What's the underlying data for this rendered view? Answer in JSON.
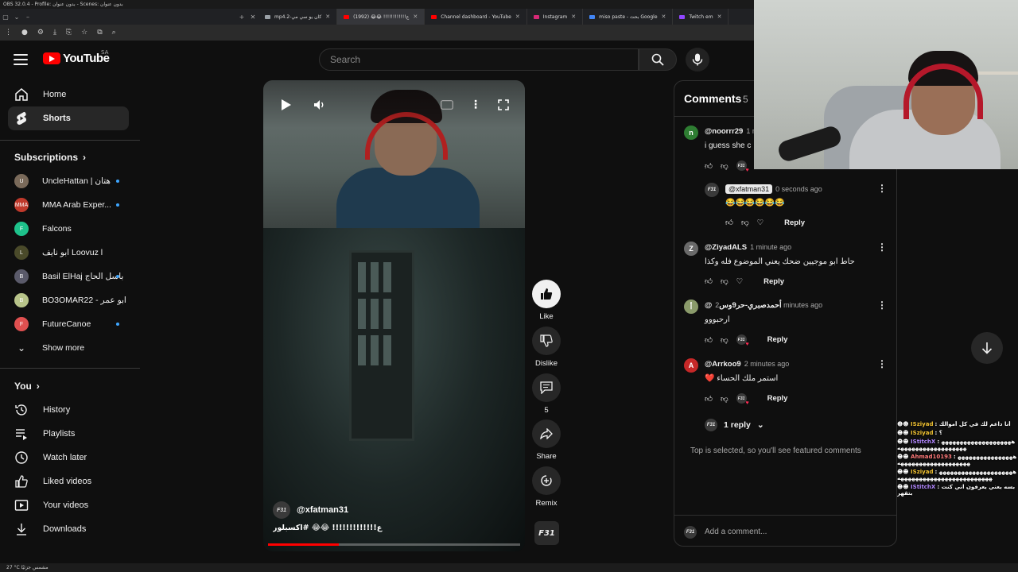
{
  "os": {
    "title": "OBS 32.0.4 - Profile: بدون عنوان - Scenes: بدون عنوان"
  },
  "browser": {
    "tabs": [
      {
        "label": "mp4.2-كان يو سي مي",
        "color": "#9aa0a6"
      },
      {
        "label": "ع!!!!!!!!!!!! 😂😂 (1992)",
        "color": "#ff0000",
        "active": true
      },
      {
        "label": "Channel dashboard - YouTube",
        "color": "#ff0000"
      },
      {
        "label": "Instagram",
        "color": "#d62976"
      },
      {
        "label": "miso paste - بحث Google",
        "color": "#4285f4"
      },
      {
        "label": "Twitch em",
        "color": "#9146ff"
      }
    ]
  },
  "header": {
    "logo_text": "YouTube",
    "country_code": "SA",
    "search_placeholder": "Search"
  },
  "sidebar": {
    "nav": [
      {
        "label": "Home",
        "icon": "home-icon"
      },
      {
        "label": "Shorts",
        "icon": "shorts-icon",
        "active": true
      }
    ],
    "subscriptions_title": "Subscriptions",
    "subscriptions": [
      {
        "name": "UncleHattan | هتان",
        "color": "#7a6a5a",
        "initial": "U",
        "new": true
      },
      {
        "name": "MMA Arab Exper...",
        "color": "#c0392b",
        "initial": "MMA",
        "new": true
      },
      {
        "name": "Falcons",
        "color": "#1ec28b",
        "initial": "F",
        "new": false
      },
      {
        "name": "ابو نايف Loovuz l",
        "color": "#4a4a2a",
        "initial": "L",
        "new": false
      },
      {
        "name": "Basil ElHaj باسل الحاج",
        "color": "#5a5a6a",
        "initial": "B",
        "new": true
      },
      {
        "name": "BO3OMAR22 - ابو عمر",
        "color": "#b8c48a",
        "initial": "B",
        "new": false
      },
      {
        "name": "FutureCanoe",
        "color": "#e05050",
        "initial": "F",
        "new": true
      }
    ],
    "show_more": "Show more",
    "you_title": "You",
    "you_items": [
      {
        "label": "History",
        "icon": "history-icon"
      },
      {
        "label": "Playlists",
        "icon": "playlists-icon"
      },
      {
        "label": "Watch later",
        "icon": "watch-later-icon"
      },
      {
        "label": "Liked videos",
        "icon": "liked-videos-icon"
      },
      {
        "label": "Your videos",
        "icon": "your-videos-icon"
      },
      {
        "label": "Downloads",
        "icon": "downloads-icon"
      }
    ]
  },
  "short": {
    "channel_handle": "@xfatman31",
    "channel_avatar_text": "F31",
    "title": "ع!!!!!!!!!!!!! 😂😂 #اكسبلور",
    "progress_percent": 28
  },
  "actions": {
    "like_label": "Like",
    "dislike_label": "Dislike",
    "comments_count": "5",
    "share_label": "Share",
    "remix_label": "Remix",
    "sound_tile_text": "F31"
  },
  "comments": {
    "title": "Comments",
    "count": "5",
    "items": [
      {
        "author": "@noorrr29",
        "time": "1 minute ago",
        "text": "i guess she c",
        "avatar": "n",
        "avatar_color": "#2e7d32"
      },
      {
        "author": "@xfatman31",
        "time": "0 seconds ago",
        "text": "😂😂😂😂😂😂",
        "avatar": "F31",
        "avatar_color": "#3a3a3a"
      },
      {
        "author": "@ZiyadALS",
        "time": "1 minute ago",
        "text": "حاط ابو موجيين ضحك يعني الموضوع فله وكذا",
        "avatar": "Z",
        "avatar_color": "#6a6a6a"
      },
      {
        "author": "@أحمدصبري-حر9وس",
        "time": "2 minutes ago",
        "text": "ارحبووو",
        "avatar": "أ",
        "avatar_color": "#8a9a6a"
      },
      {
        "author": "@Arrkoo9",
        "time": "2 minutes ago",
        "text": "❤️ استمر ملك الحساء",
        "avatar": "A",
        "avatar_color": "#c62828"
      }
    ],
    "reply_label": "Reply",
    "replies_toggle": "1 reply",
    "featured_note": "Top is selected, so you'll see featured comments",
    "add_placeholder": "Add a comment..."
  },
  "chat": {
    "lines": [
      {
        "user": "ISziyad",
        "user_color": "#f1c232",
        "text": "أنا داعم لك في كل أموالك"
      },
      {
        "user": "ISziyad",
        "user_color": "#f1c232",
        "text": "؟"
      },
      {
        "user": "IStitchX",
        "user_color": "#b388ff",
        "text": "ههههههههههههههههههههههههههههههههههههههه"
      },
      {
        "user": "Ahmad10193",
        "user_color": "#ff7a7a",
        "text": "هههههههههههههههههههههههههههههههههههه"
      },
      {
        "user": "ISziyad",
        "user_color": "#f1c232",
        "text": "ههههههههههههههههههههههههههههههههههههههههههههههه"
      },
      {
        "user": "IStitchX",
        "user_color": "#b388ff",
        "text": "بسه يعني يعرفون اني كنت بتقهر"
      }
    ]
  },
  "taskbar": {
    "text": "27 °C    مشمس جزئيًا"
  }
}
